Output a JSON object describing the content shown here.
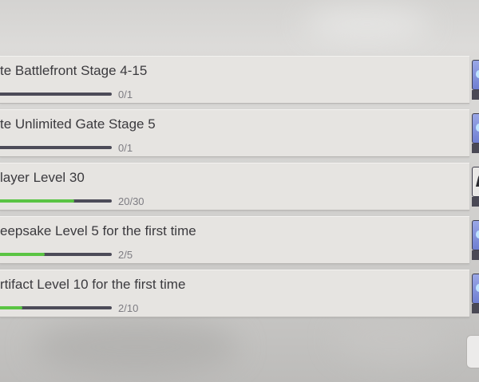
{
  "missions": [
    {
      "title": "te Battlefront Stage 4-15",
      "progress": "0/1",
      "fraction": 0.0,
      "reward_icon": "gem-icon"
    },
    {
      "title": "te Unlimited Gate Stage 5",
      "progress": "0/1",
      "fraction": 0.0,
      "reward_icon": "gem-icon"
    },
    {
      "title": "layer Level 30",
      "progress": "20/30",
      "fraction": 0.667,
      "reward_icon": "character-icon"
    },
    {
      "title": "eepsake Level 5 for the first time",
      "progress": "2/5",
      "fraction": 0.4,
      "reward_icon": "gem-icon"
    },
    {
      "title": "rtifact Level 10 for the first time",
      "progress": "2/10",
      "fraction": 0.2,
      "reward_icon": "gem-icon"
    }
  ],
  "colors": {
    "progress_fill": "#5ac443",
    "progress_track": "#4c4b58",
    "panel": "#e6e4e1"
  }
}
